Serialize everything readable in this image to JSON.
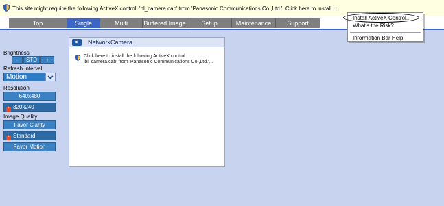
{
  "infobar": {
    "message": "This site might require the following ActiveX control: 'bl_camera.cab' from 'Panasonic Communications Co.,Ltd.'. Click here to install..."
  },
  "nav": {
    "tabs": [
      {
        "label": "Top"
      },
      {
        "label": "Single"
      },
      {
        "label": "Multi"
      },
      {
        "label": "Buffered Image"
      },
      {
        "label": "Setup"
      },
      {
        "label": "Maintenance"
      },
      {
        "label": "Support"
      }
    ]
  },
  "menu": {
    "items": [
      {
        "label": "Install ActiveX Control..."
      },
      {
        "label": "What's the Risk?"
      },
      {
        "label": "Information Bar Help"
      }
    ]
  },
  "left": {
    "brightness_label": "Brightness",
    "brightness_minus": "-",
    "brightness_std": "STD",
    "brightness_plus": "+",
    "refresh_label": "Refresh Interval",
    "refresh_value": "Motion",
    "resolution_label": "Resolution",
    "res_640": "640x480",
    "res_320": "320x240",
    "quality_label": "Image Quality",
    "q_clarity": "Favor Clarity",
    "q_standard": "Standard",
    "q_motion": "Favor Motion"
  },
  "camera": {
    "title": "NetworkCamera",
    "install_line1": "Click here to install the following ActiveX control:",
    "install_line2": "'bl_camera.cab' from 'Panasonic Communications Co.,Ltd.'..."
  },
  "colors": {
    "nav_active": "#3b66c7",
    "nav_inactive": "#7f7f7f",
    "panel_bg": "#c8d3ef",
    "button_blue": "#3a82c4",
    "infobar_bg": "#ffffe1"
  }
}
